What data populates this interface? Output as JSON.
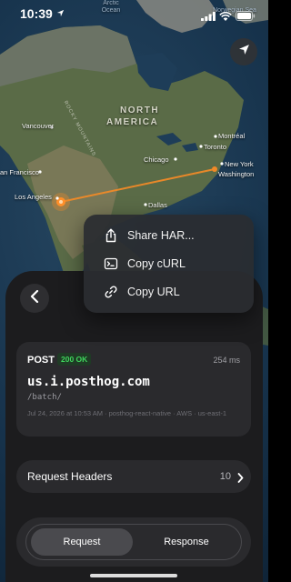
{
  "status_bar": {
    "time": "10:39",
    "icons": [
      "location-arrow-icon",
      "signal-icon",
      "wifi-icon",
      "battery-icon"
    ]
  },
  "map": {
    "continent_label_line1": "NORTH",
    "continent_label_line2": "AMERICA",
    "oceans": [
      "Arctic Ocean",
      "Norwegian Sea"
    ],
    "mountain_label": "ROCKY MOUNTAINS",
    "cities": {
      "vancouver": "Vancouver",
      "san_francisco": "an Francisco",
      "los_angeles": "Los Angeles",
      "chicago": "Chicago",
      "dallas": "Dallas",
      "toronto": "Toronto",
      "montreal": "Montréal",
      "new_york": "New York",
      "washington": "Washington"
    },
    "route_color": "#f08a28"
  },
  "context_menu": {
    "items": [
      {
        "label": "Share HAR...",
        "icon": "share-icon"
      },
      {
        "label": "Copy cURL",
        "icon": "terminal-icon"
      },
      {
        "label": "Copy URL",
        "icon": "link-icon"
      }
    ]
  },
  "request": {
    "method": "POST",
    "status": "200 OK",
    "status_color": "#3fd45c",
    "duration": "254 ms",
    "host": "us.i.posthog.com",
    "path": "/batch/",
    "meta": "Jul 24, 2026 at 10:53 AM · posthog-react-native · AWS · us-east-1"
  },
  "headers_row": {
    "label": "Request Headers",
    "count": "10"
  },
  "tabs": {
    "request": "Request",
    "response": "Response",
    "selected": "Request"
  }
}
